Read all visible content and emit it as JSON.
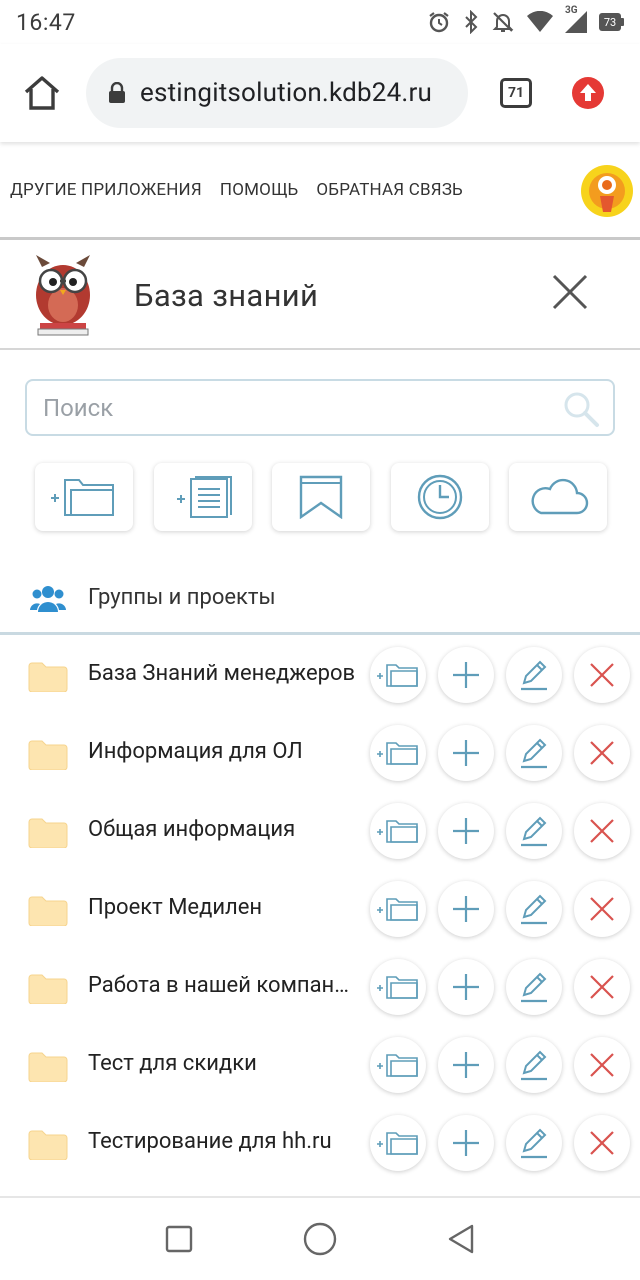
{
  "status_bar": {
    "time": "16:47",
    "network": "3G",
    "battery": "73",
    "icons": [
      "alarm-icon",
      "bluetooth-icon",
      "mute-icon",
      "wifi-icon",
      "signal-icon",
      "battery-icon"
    ]
  },
  "browser": {
    "url": "estingitsolution.kdb24.ru",
    "tab_count": "71"
  },
  "site_nav": {
    "links": [
      "ДРУГИЕ ПРИЛОЖЕНИЯ",
      "ПОМОЩЬ",
      "ОБРАТНАЯ СВЯЗЬ"
    ]
  },
  "header": {
    "title": "База знаний"
  },
  "search": {
    "placeholder": "Поиск"
  },
  "toolbar": {
    "icons": [
      "add-folder-icon",
      "add-article-icon",
      "bookmark-icon",
      "clock-icon",
      "cloud-icon"
    ]
  },
  "groups": {
    "label": "Группы и проекты"
  },
  "folders": [
    {
      "name": "База Знаний менеджеров"
    },
    {
      "name": "Информация для ОЛ"
    },
    {
      "name": "Общая информация"
    },
    {
      "name": "Проект Медилен"
    },
    {
      "name": "Работа в нашей компании"
    },
    {
      "name": "Тест для скидки"
    },
    {
      "name": "Тестирование для hh.ru"
    }
  ],
  "colors": {
    "accent": "#5f9db9",
    "delete": "#d9534f",
    "folder": "#fde5b0",
    "update": "#e53935"
  }
}
